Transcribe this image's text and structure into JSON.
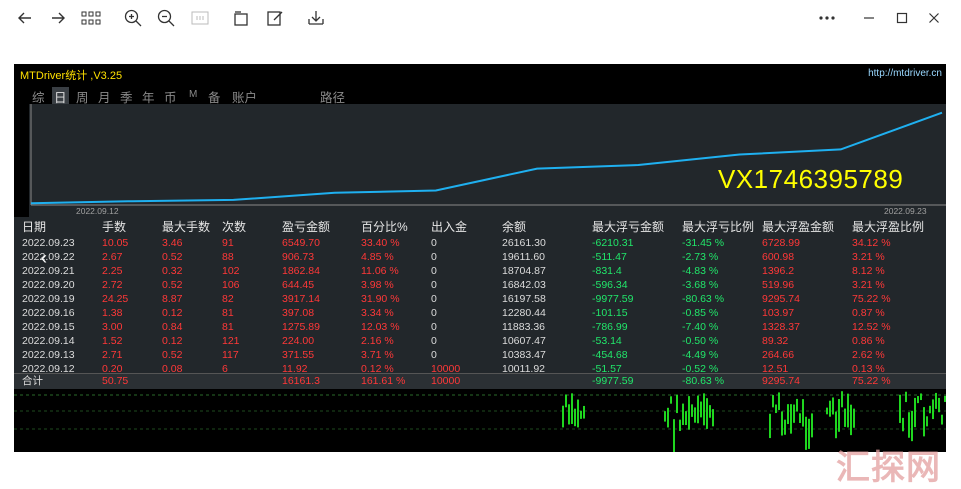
{
  "toolbar": {
    "left_icons": [
      "back-arrow-icon",
      "forward-arrow-icon",
      "grid-icon",
      "zoom-in-icon",
      "zoom-out-icon",
      "fit-icon",
      "rotate-icon",
      "edit-icon",
      "download-icon"
    ],
    "right_icons": [
      "more-icon",
      "minimize-icon",
      "maximize-icon",
      "close-icon"
    ]
  },
  "panel": {
    "title": "MTDriver统计 ,V3.25",
    "url": "http://mtdriver.cn",
    "tabs": [
      "综",
      "日",
      "周",
      "月",
      "季",
      "年",
      "币",
      "M",
      "备",
      "账户",
      "路径"
    ],
    "active_tab": "日"
  },
  "chart": {
    "start_label": "2022.09.12",
    "end_label": "2022.09.23",
    "overlay_text": "VX1746395789",
    "line_color": "#1fb0f0"
  },
  "chart_data": {
    "type": "line",
    "x": [
      "2022.09.12",
      "2022.09.13",
      "2022.09.14",
      "2022.09.15",
      "2022.09.16",
      "2022.09.19",
      "2022.09.20",
      "2022.09.21",
      "2022.09.22",
      "2022.09.23"
    ],
    "values": [
      10011.92,
      10383.47,
      10607.47,
      11883.36,
      12280.44,
      16197.58,
      16842.03,
      18704.87,
      19611.6,
      26161.3
    ],
    "ylim": [
      9700,
      27000
    ]
  },
  "table": {
    "headers": [
      "日期",
      "手数",
      "最大手数",
      "次数",
      "盈亏金额",
      "百分比%",
      "出入金",
      "余额",
      "最大浮亏金额",
      "最大浮亏比例",
      "最大浮盈金额",
      "最大浮盈比例"
    ],
    "rows": [
      [
        "2022.09.23",
        "10.05",
        "3.46",
        "91",
        "6549.70",
        "33.40 %",
        "0",
        "26161.30",
        "-6210.31",
        "-31.45 %",
        "6728.99",
        "34.12 %"
      ],
      [
        "2022.09.22",
        "2.67",
        "0.52",
        "88",
        "906.73",
        "4.85 %",
        "0",
        "19611.60",
        "-511.47",
        "-2.73 %",
        "600.98",
        "3.21 %"
      ],
      [
        "2022.09.21",
        "2.25",
        "0.32",
        "102",
        "1862.84",
        "11.06 %",
        "0",
        "18704.87",
        "-831.4",
        "-4.83 %",
        "1396.2",
        "8.12 %"
      ],
      [
        "2022.09.20",
        "2.72",
        "0.52",
        "106",
        "644.45",
        "3.98 %",
        "0",
        "16842.03",
        "-596.34",
        "-3.68 %",
        "519.96",
        "3.21 %"
      ],
      [
        "2022.09.19",
        "24.25",
        "8.87",
        "82",
        "3917.14",
        "31.90 %",
        "0",
        "16197.58",
        "-9977.59",
        "-80.63 %",
        "9295.74",
        "75.22 %"
      ],
      [
        "2022.09.16",
        "1.38",
        "0.12",
        "81",
        "397.08",
        "3.34 %",
        "0",
        "12280.44",
        "-101.15",
        "-0.85 %",
        "103.97",
        "0.87 %"
      ],
      [
        "2022.09.15",
        "3.00",
        "0.84",
        "81",
        "1275.89",
        "12.03 %",
        "0",
        "11883.36",
        "-786.99",
        "-7.40 %",
        "1328.37",
        "12.52 %"
      ],
      [
        "2022.09.14",
        "1.52",
        "0.12",
        "121",
        "224.00",
        "2.16 %",
        "0",
        "10607.47",
        "-53.14",
        "-0.50 %",
        "89.32",
        "0.86 %"
      ],
      [
        "2022.09.13",
        "2.71",
        "0.52",
        "117",
        "371.55",
        "3.71 %",
        "0",
        "10383.47",
        "-454.68",
        "-4.49 %",
        "264.66",
        "2.62 %"
      ],
      [
        "2022.09.12",
        "0.20",
        "0.08",
        "6",
        "11.92",
        "0.12 %",
        "10000",
        "10011.92",
        "-51.57",
        "-0.52 %",
        "12.51",
        "0.13 %"
      ]
    ],
    "total": [
      "合计",
      "50.75",
      "",
      "",
      "16161.3",
      "161.61 %",
      "10000",
      "",
      "-9977.59",
      "-80.63 %",
      "9295.74",
      "75.22 %"
    ],
    "colors": {
      "white": "#dcdcdc",
      "red": "#ff3838",
      "green": "#21e66a"
    }
  },
  "watermark": "汇探网"
}
